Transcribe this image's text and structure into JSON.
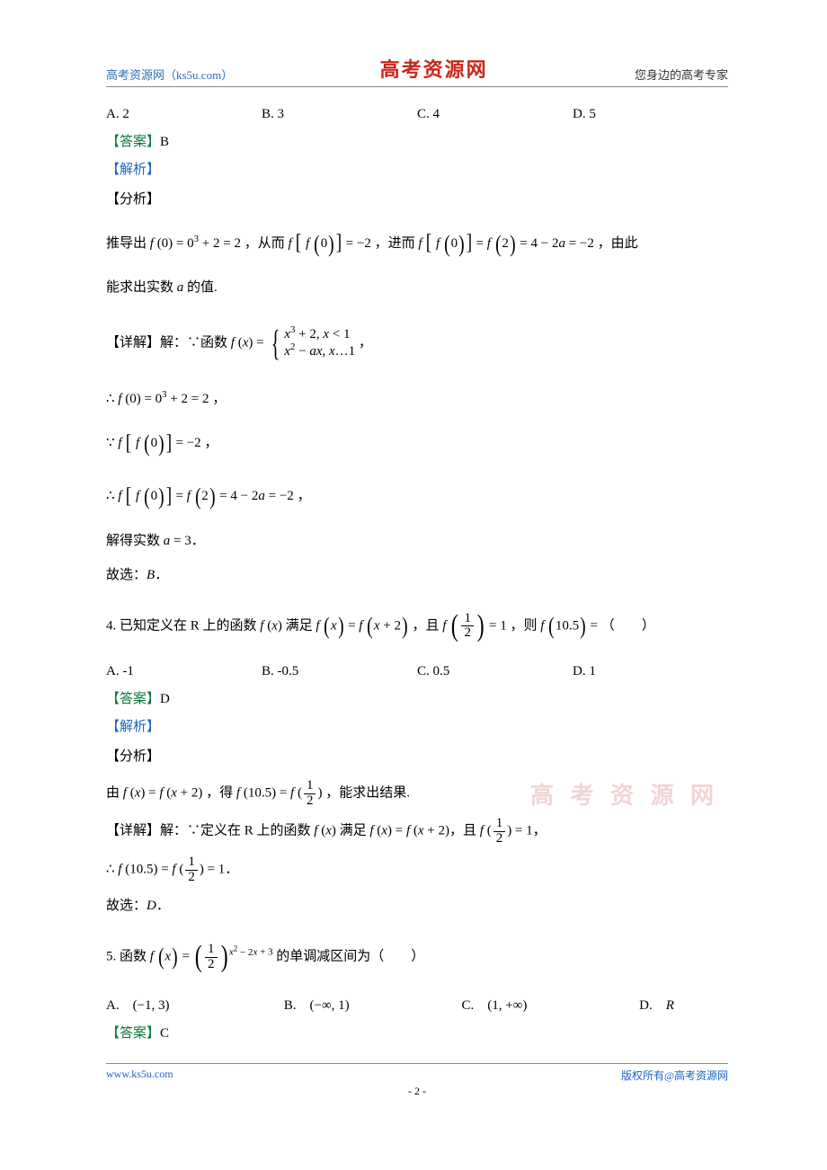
{
  "header": {
    "left": "高考资源网（ks5u.com）",
    "center": "高考资源网",
    "right": "您身边的高考专家"
  },
  "watermark": "高 考 资 源 网",
  "q3": {
    "choices": {
      "A": "A. 2",
      "B": "B. 3",
      "C": "C. 4",
      "D": "D. 5"
    },
    "answer_label": "【答案】",
    "answer": "B",
    "analysis_label": "【解析】",
    "fx_label": "【分析】",
    "fx_text_1": "推导出 ",
    "fx_math_1": "f (0) = 0³ + 2 = 2",
    "fx_text_2": "，从而 ",
    "fx_math_2": "f [ f (0) ] = −2",
    "fx_text_3": "，进而 ",
    "fx_math_3": "f [ f (0) ] = f (2) = 4 − 2a = −2",
    "fx_text_4": "，由此",
    "fx_line2": "能求出实数 ",
    "fx_a": "a",
    "fx_line2b": " 的值.",
    "detail_label": "【详解】解：∵函数 ",
    "detail_fx": "f (x) =",
    "pw_row1": "x³ + 2, x < 1",
    "pw_row2": "x² − ax, x…1",
    "detail_tail": "，",
    "l1": "∴ f (0) = 0³ + 2 = 2 ，",
    "l2": "∵ f [ f (0) ] = −2 ，",
    "l3": "∴ f [ f (0) ] = f (2) = 4 − 2a = −2 ，",
    "l4a": "解得实数 ",
    "l4b": "a = 3",
    "l4c": "．",
    "l5": "故选：",
    "l5b": "B",
    "l5c": "．"
  },
  "q4": {
    "stem_a": "4. 已知定义在 R 上的函数 ",
    "stem_b": " 满足 ",
    "stem_c": "，且 ",
    "stem_d": "，则 ",
    "stem_e": "（　　）",
    "fx": "f (x)",
    "eq1a": "f (x) = f (x + 2)",
    "eq2": "f",
    "half_num": "1",
    "half_den": "2",
    "eq2_val": " = 1",
    "eq3": "f (10.5) =",
    "choices": {
      "A": "A.  -1",
      "B": "B.  -0.5",
      "C": "C.  0.5",
      "D": "D.  1"
    },
    "answer_label": "【答案】",
    "answer": "D",
    "analysis_label": "【解析】",
    "fx_label": "【分析】",
    "ana_a": "由 ",
    "ana_b": "f (x) = f (x + 2)",
    "ana_c": "，得 ",
    "ana_d": "f (10.5) = f (",
    "ana_e": ")",
    "ana_f": "，能求出结果.",
    "det_a": "【详解】解：∵定义在 R 上的函数 ",
    "det_b": " 满足 ",
    "det_c": "f (x) = f (x + 2)",
    "det_d": "，且 ",
    "det_e": "f (",
    "det_f": ") = 1",
    "det_g": "，",
    "res_a": "∴ f (10.5) = f (",
    "res_b": ") = 1",
    "res_c": "．",
    "sel": "故选：",
    "selb": "D",
    "selc": "．"
  },
  "q5": {
    "stem_a": "5. 函数 ",
    "stem_b": " 的单调减区间为（　　）",
    "fx": "f (x) =",
    "base_num": "1",
    "base_den": "2",
    "exp": "x² − 2x + 3",
    "choices": {
      "A": "A.　(−1, 3)",
      "B": "B.　(−∞, 1)",
      "C": "C.　(1, +∞)",
      "D": "D.　R"
    },
    "answer_label": "【答案】",
    "answer": "C"
  },
  "footer": {
    "left": "www.ks5u.com",
    "center": "- 2 -",
    "right": "版权所有@高考资源网"
  }
}
